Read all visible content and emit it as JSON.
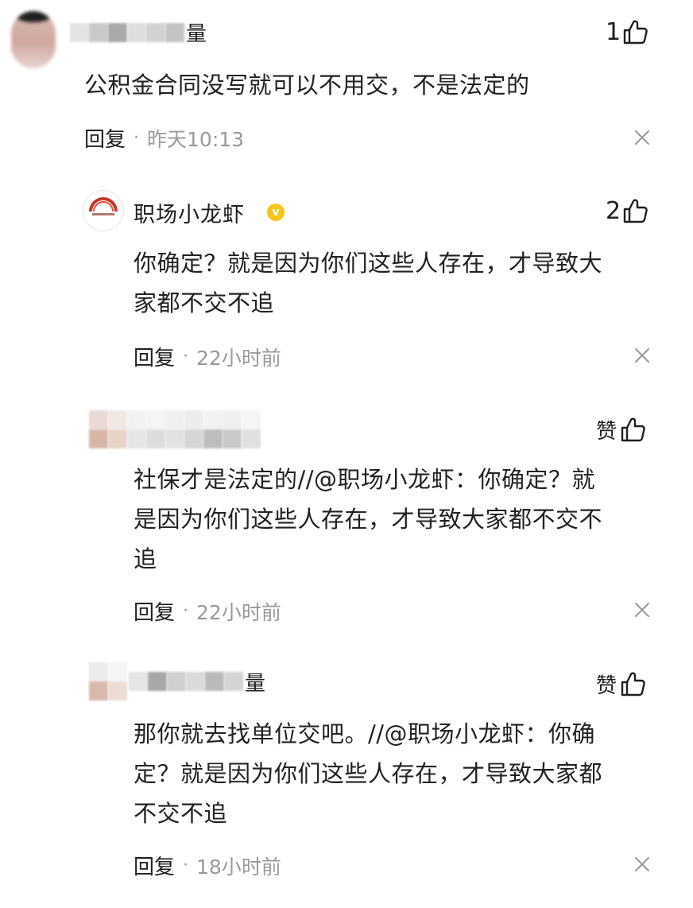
{
  "comments": [
    {
      "author_suffix": "量",
      "text": "公积金合同没写就可以不用交，不是法定的",
      "likes": "1",
      "reply_label": "回复",
      "dot": "·",
      "time": "昨天10:13"
    },
    {
      "author": "职场小龙虾",
      "verified_badge": "v",
      "text_line1": "你确定？就是因为你们这些人存在，才导致大",
      "text_line2": "家都不交不追",
      "likes": "2",
      "reply_label": "回复",
      "dot": "·",
      "time": "22小时前"
    },
    {
      "like_label": "赞",
      "text_line1": "社保才是法定的//@职场小龙虾：你确定？就",
      "text_line2": "是因为你们这些人存在，才导致大家都不交不",
      "text_line3": "追",
      "reply_label": "回复",
      "dot": "·",
      "time": "22小时前"
    },
    {
      "author_suffix": "量",
      "like_label": "赞",
      "text_line1": "那你就去找单位交吧。//@职场小龙虾：你确",
      "text_line2": "定？就是因为你们这些人存在，才导致大家都",
      "text_line3": "不交不追",
      "reply_label": "回复",
      "dot": "·",
      "time": "18小时前"
    }
  ],
  "colors": {
    "text": "#1f1f1f",
    "muted": "#9a9a9a",
    "badge": "#f5c518",
    "brand_red": "#c0392b"
  },
  "icons": {
    "like": "thumbs-up-icon",
    "close": "close-icon",
    "verified": "verified-badge-icon"
  }
}
